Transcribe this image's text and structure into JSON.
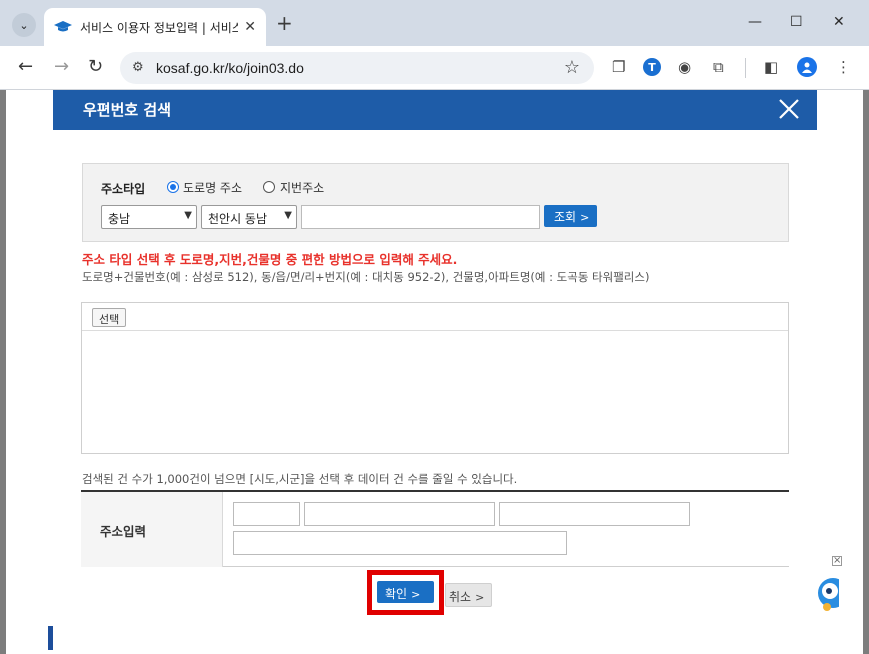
{
  "browser": {
    "tab_title": "서비스 이용자 정보입력 | 서비스 이용",
    "url": "kosaf.go.kr/ko/join03.do"
  },
  "modal": {
    "title": "우편번호 검색",
    "address_type_label": "주소타입",
    "radio_road": "도로명 주소",
    "radio_lot": "지번주소",
    "selected_type": "도로명 주소",
    "province_select": "충남",
    "city_select": "천안시 동남",
    "search_input_value": "",
    "query_button": "조회",
    "notice_red": "주소 타입 선택 후 도로명,지번,건물명 중 편한 방법으로 입력해 주세요.",
    "notice_gray": "도로명+건물번호(예 : 삼성로 512), 동/읍/면/리+번지(예 : 대치동 952-2), 건물명,아파트명(예 : 도곡동 타워팰리스)",
    "select_button": "선택",
    "count_note": "검색된 건 수가 1,000건이 넘으면 [시도,시군]을 선택 후 데이터 건 수를 줄일 수 있습니다.",
    "address_input_label": "주소입력",
    "confirm_button": "확인",
    "cancel_button": "취소"
  },
  "colors": {
    "header_blue": "#1e5ca8",
    "button_blue": "#1a6fc4",
    "notice_red": "#e8312b",
    "highlight_red": "#e00000"
  }
}
